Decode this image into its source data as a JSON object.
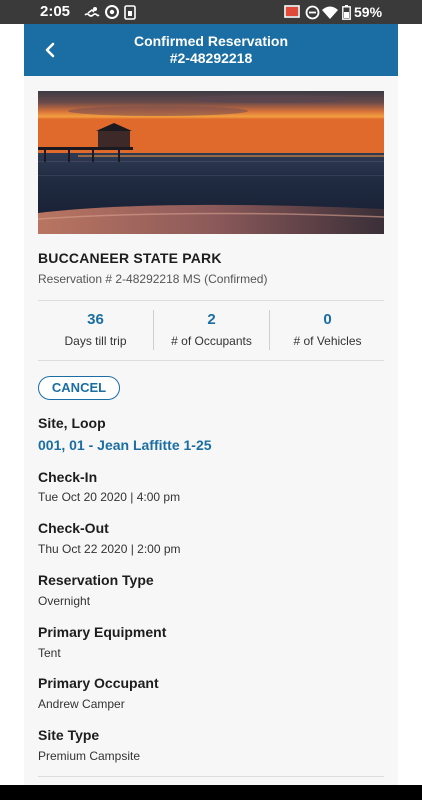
{
  "status_bar": {
    "time": "2:05",
    "battery": "59%"
  },
  "header": {
    "title_line1": "Confirmed Reservation",
    "title_line2": "#2-48292218"
  },
  "park": {
    "name": "BUCCANEER STATE PARK",
    "reservation_line": "Reservation # 2-48292218 MS (Confirmed)"
  },
  "stats": [
    {
      "value": "36",
      "label": "Days till trip"
    },
    {
      "value": "2",
      "label": "# of Occupants"
    },
    {
      "value": "0",
      "label": "# of Vehicles"
    }
  ],
  "cancel_label": "CANCEL",
  "details": {
    "site_loop_label": "Site, Loop",
    "site_loop_value": "001, 01 - Jean Laffitte 1-25",
    "checkin_label": "Check-In",
    "checkin_value": "Tue Oct 20 2020 | 4:00 pm",
    "checkout_label": "Check-Out",
    "checkout_value": "Thu Oct 22 2020 | 2:00 pm",
    "res_type_label": "Reservation Type",
    "res_type_value": "Overnight",
    "equipment_label": "Primary Equipment",
    "equipment_value": "Tent",
    "occupant_label": "Primary Occupant",
    "occupant_value": "Andrew Camper",
    "site_type_label": "Site Type",
    "site_type_value": "Premium Campsite"
  },
  "colors": {
    "brand_blue": "#1b6ea3",
    "status_bar": "#3a3a3a"
  }
}
